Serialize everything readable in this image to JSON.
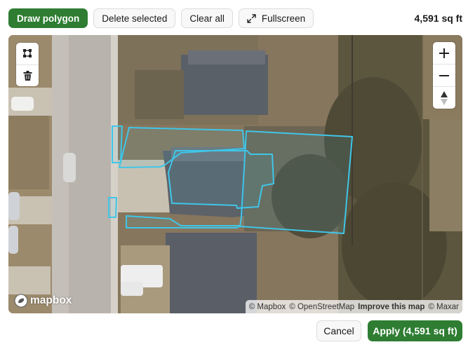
{
  "toolbar": {
    "draw_polygon": "Draw polygon",
    "delete_selected": "Delete selected",
    "clear_all": "Clear all",
    "fullscreen": "Fullscreen"
  },
  "area_readout": "4,591 sq ft",
  "map": {
    "logo_text": "mapbox",
    "attribution": {
      "mapbox": "© Mapbox",
      "osm": "© OpenStreetMap",
      "improve": "Improve this map",
      "maxar": "© Maxar"
    },
    "draw_controls": [
      "polygon-tool-icon",
      "trash-icon"
    ],
    "nav_controls": [
      "zoom-in-icon",
      "zoom-out-icon",
      "compass-icon"
    ],
    "polygon_color": "#3fc6e8"
  },
  "footer": {
    "cancel": "Cancel",
    "apply": "Apply (4,591 sq ft)"
  },
  "colors": {
    "primary": "#2e7d32",
    "outline": "#3fc6e8"
  }
}
